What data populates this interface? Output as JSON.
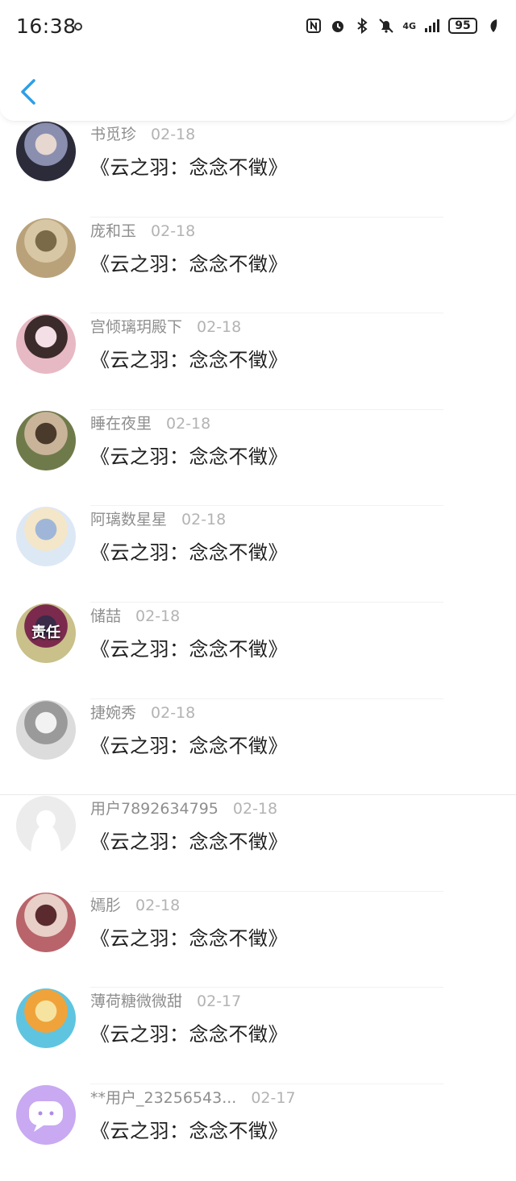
{
  "status_bar": {
    "time": "16:38",
    "network": "4G",
    "battery": "95"
  },
  "nav": {
    "back_icon": "chevron-left-icon"
  },
  "items": [
    {
      "name": "书觅珍",
      "date": "02-18",
      "title": "《云之羽：念念不徵》",
      "avatar_colors": [
        "#2b2b3a",
        "#8a8fb0",
        "#e6d7d0"
      ]
    },
    {
      "name": "庞和玉",
      "date": "02-18",
      "title": "《云之羽：念念不徵》",
      "avatar_colors": [
        "#b9a27a",
        "#d8c7a4",
        "#7b6a48"
      ]
    },
    {
      "name": "宫倾璃玥殿下",
      "date": "02-18",
      "title": "《云之羽：念念不徵》",
      "avatar_colors": [
        "#e7b9c4",
        "#3b2b2b",
        "#f3dfe5"
      ]
    },
    {
      "name": "睡在夜里",
      "date": "02-18",
      "title": "《云之羽：念念不徵》",
      "avatar_colors": [
        "#6f7a4a",
        "#c9b49a",
        "#4a3a2c"
      ]
    },
    {
      "name": "阿璃数星星",
      "date": "02-18",
      "title": "《云之羽：念念不徵》",
      "avatar_colors": [
        "#dde8f5",
        "#f4e6c8",
        "#9fb6d8"
      ]
    },
    {
      "name": "储喆",
      "date": "02-18",
      "title": "《云之羽：念念不徵》",
      "avatar_text": "责任",
      "avatar_colors": [
        "#c9c08a",
        "#7b2a4e",
        "#3a2b48"
      ]
    },
    {
      "name": "捷婉秀",
      "date": "02-18",
      "title": "《云之羽：念念不徵》",
      "avatar_colors": [
        "#dcdcdc",
        "#9a9a9a",
        "#f2f2f2"
      ]
    },
    {
      "name": "用户7892634795",
      "date": "02-18",
      "title": "《云之羽：念念不徵》",
      "avatar_colors": [
        "#efefef",
        "#ffffff",
        "#e2e2e2"
      ]
    },
    {
      "name": "嫣肜",
      "date": "02-18",
      "title": "《云之羽：念念不徵》",
      "avatar_colors": [
        "#b8646a",
        "#e8cfc8",
        "#5a2a2e"
      ]
    },
    {
      "name": "薄荷糖微微甜",
      "date": "02-17",
      "title": "《云之羽：念念不徵》",
      "avatar_colors": [
        "#5fc4e0",
        "#f0a33a",
        "#f6e3a0"
      ]
    },
    {
      "name": "**用户_23256543...",
      "date": "02-17",
      "title": "《云之羽：念念不徵》",
      "avatar_colors": [
        "#c8a9f2",
        "#ffffff",
        "#b08ae8"
      ]
    }
  ]
}
